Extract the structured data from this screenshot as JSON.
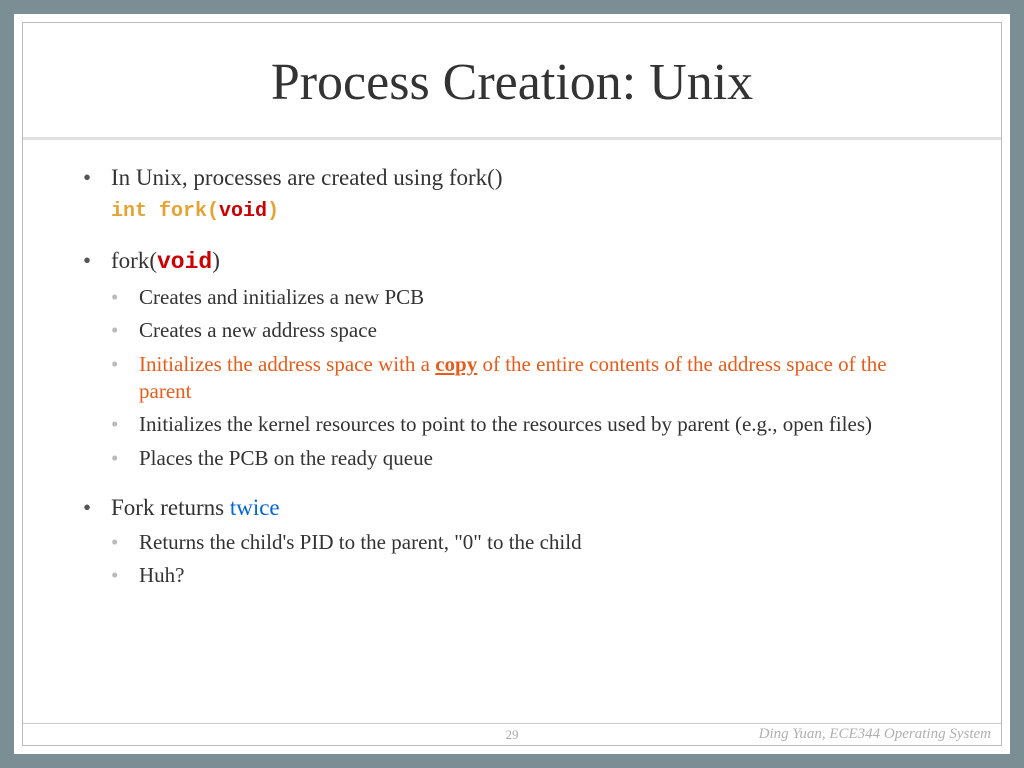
{
  "title": "Process Creation: Unix",
  "bullets": {
    "b1_main": "In Unix, processes are created using fork()",
    "b1_code_int_fork": "int fork(",
    "b1_code_void": "void",
    "b1_code_close": ")",
    "b2_prefix": "fork(",
    "b2_void": "void",
    "b2_suffix": ")",
    "b2_sub1": "Creates and initializes a new PCB",
    "b2_sub2": "Creates a new address space",
    "b2_sub3_a": "Initializes the address space with a ",
    "b2_sub3_copy": "copy",
    "b2_sub3_b": " of the entire contents of the address space of the parent",
    "b2_sub4": "Initializes the kernel resources to point to the resources used by parent (e.g., open files)",
    "b2_sub5": "Places the PCB on the ready queue",
    "b3_prefix": "Fork returns ",
    "b3_twice": "twice",
    "b3_sub1": "Returns the child's PID to the parent, \"0\" to the child",
    "b3_sub2": "Huh?"
  },
  "footer": {
    "page": "29",
    "author": "Ding Yuan, ECE344 Operating System"
  }
}
